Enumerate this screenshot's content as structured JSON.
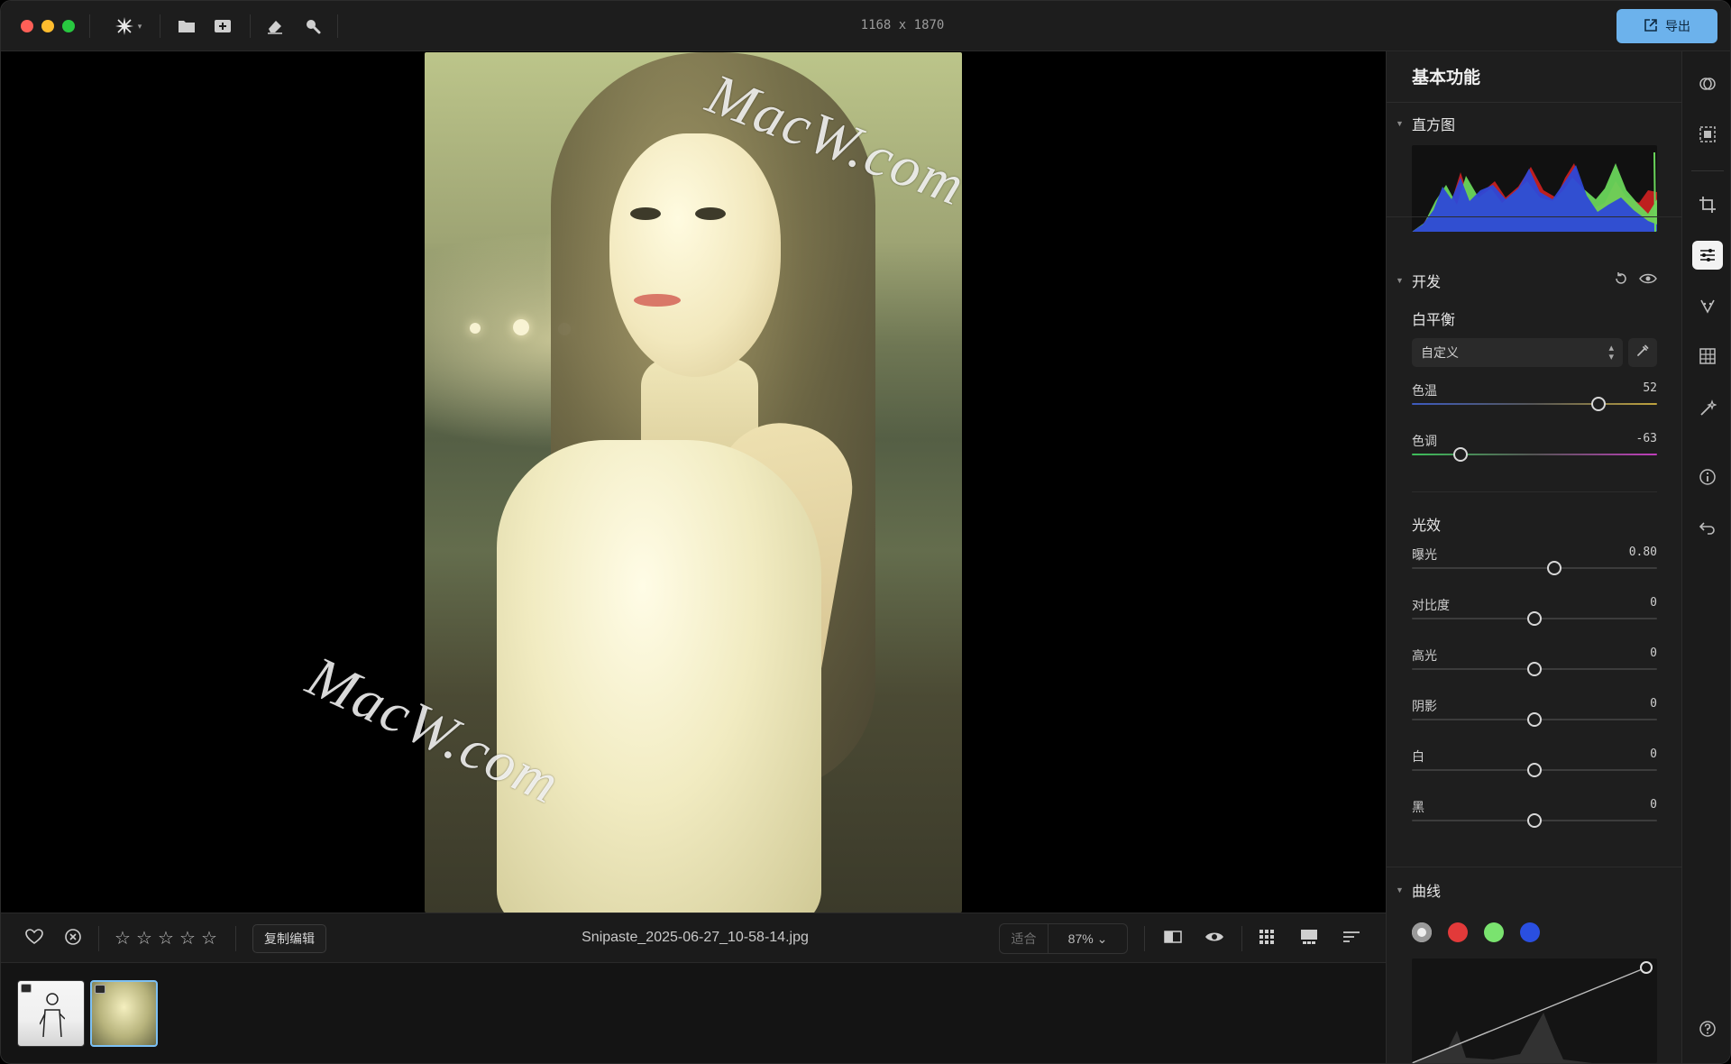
{
  "titlebar": {
    "dimensions": "1168 x 1870",
    "export_label": "导出",
    "tools": [
      "sparkle-icon",
      "folder-icon",
      "add-photo-icon",
      "eraser-icon",
      "magnifier-icon"
    ]
  },
  "watermark": {
    "text": "MacW.com"
  },
  "bottom_bar": {
    "copy_edit_label": "复制编辑",
    "filename": "Snipaste_2025-06-27_10-58-14.jpg",
    "fit_label": "适合",
    "zoom_label": "87% ⌄",
    "rating": {
      "stars": [
        "☆",
        "☆",
        "☆",
        "☆",
        "☆"
      ],
      "value": 0,
      "max": 5
    }
  },
  "filmstrip": {
    "thumbnails": [
      {
        "selected": false
      },
      {
        "selected": true
      }
    ]
  },
  "panel": {
    "title": "基本功能",
    "histogram": {
      "label": "直方图"
    },
    "develop": {
      "label": "开发",
      "white_balance": {
        "label": "白平衡",
        "preset": "自定义",
        "temperature": {
          "label": "色温",
          "value": "52",
          "fraction": 0.76
        },
        "tint": {
          "label": "色调",
          "value": "-63",
          "fraction": 0.2
        }
      },
      "light": {
        "label": "光效",
        "sliders": [
          {
            "label": "曝光",
            "value": "0.80",
            "fraction": 0.58
          },
          {
            "label": "对比度",
            "value": "0",
            "fraction": 0.5
          },
          {
            "label": "高光",
            "value": "0",
            "fraction": 0.5
          },
          {
            "label": "阴影",
            "value": "0",
            "fraction": 0.5
          },
          {
            "label": "白",
            "value": "0",
            "fraction": 0.5
          },
          {
            "label": "黑",
            "value": "0",
            "fraction": 0.5
          }
        ]
      }
    },
    "curves": {
      "label": "曲线",
      "channels": [
        {
          "name": "rgb",
          "color": "#9a9a9a"
        },
        {
          "name": "red",
          "color": "#e23a3a"
        },
        {
          "name": "green",
          "color": "#7ae36f"
        },
        {
          "name": "blue",
          "color": "#2a4fe0"
        }
      ]
    }
  },
  "toolrail": {
    "icons": [
      "filter-icon",
      "select-icon",
      "crop-icon",
      "adjust-icon",
      "retouch-icon",
      "grid-icon",
      "magic-icon",
      "info-icon",
      "undo-icon",
      "help-icon"
    ],
    "active": "adjust-icon"
  },
  "colors": {
    "accent": "#6cb2ec",
    "background": "#161616",
    "panel": "#1e1e1e"
  }
}
